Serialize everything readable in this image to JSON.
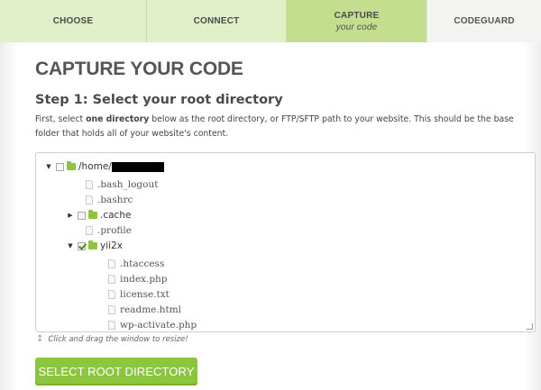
{
  "wizard": {
    "steps": [
      {
        "label": "CHOOSE",
        "sub": ""
      },
      {
        "label": "CONNECT",
        "sub": ""
      },
      {
        "label": "CAPTURE",
        "sub": "your code"
      },
      {
        "label": "CODEGUARD",
        "sub": ""
      }
    ],
    "active_index": 2
  },
  "page": {
    "title": "CAPTURE YOUR CODE",
    "step_heading": "Step 1: Select your root directory",
    "instructions_before": "First, select ",
    "instructions_bold": "one directory",
    "instructions_after": " below as the root directory, or FTP/SFTP path to your website. This should be the base folder that holds all of your website's content."
  },
  "tree": {
    "root": {
      "label": "/home/",
      "checked": false,
      "expanded": true
    },
    "items": [
      {
        "label": ".bash_logout",
        "type": "file"
      },
      {
        "label": ".bashrc",
        "type": "file"
      },
      {
        "label": ".cache",
        "type": "dir",
        "checked": false,
        "expanded": false
      },
      {
        "label": ".profile",
        "type": "file"
      },
      {
        "label": "yii2x",
        "type": "dir",
        "checked": true,
        "expanded": true
      },
      {
        "label": ".htaccess",
        "type": "file"
      },
      {
        "label": "index.php",
        "type": "file"
      },
      {
        "label": "license.txt",
        "type": "file"
      },
      {
        "label": "readme.html",
        "type": "file"
      },
      {
        "label": "wp-activate.php",
        "type": "file"
      }
    ]
  },
  "resize_hint": "Click and drag the window to resize!",
  "actions": {
    "select_root": "SELECT ROOT DIRECTORY"
  },
  "colors": {
    "step_bg": "#e1f0c9",
    "step_active_bg": "#c4de90",
    "button_bg": "#8cc63f",
    "folder": "#8cc63f"
  }
}
